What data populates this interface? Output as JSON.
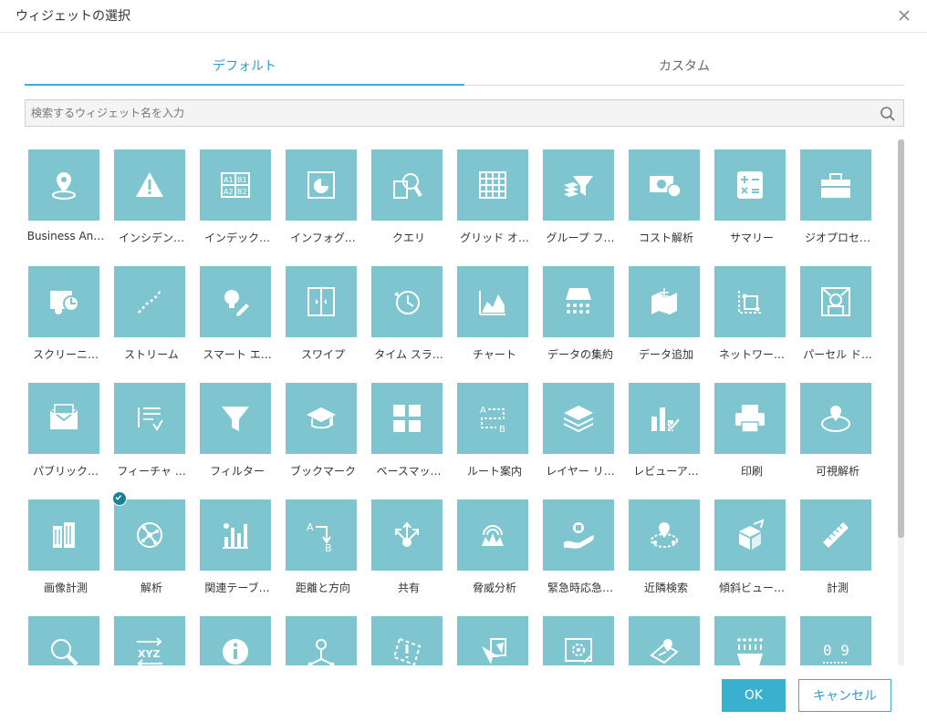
{
  "dialog": {
    "title": "ウィジェットの選択",
    "close_icon": "close-icon"
  },
  "tabs": [
    {
      "label": "デフォルト",
      "active": true
    },
    {
      "label": "カスタム",
      "active": false
    }
  ],
  "search": {
    "placeholder": "検索するウィジェット名を入力",
    "value": "",
    "icon": "search-icon"
  },
  "widgets": [
    {
      "label": "Business An…",
      "icon": "location-pin-icon"
    },
    {
      "label": "インシデン…",
      "icon": "warning-icon"
    },
    {
      "label": "インデック…",
      "icon": "index-grid-icon"
    },
    {
      "label": "インフォグ…",
      "icon": "pie-chart-icon"
    },
    {
      "label": "クエリ",
      "icon": "query-icon"
    },
    {
      "label": "グリッド オ…",
      "icon": "grid-icon"
    },
    {
      "label": "グループ フ…",
      "icon": "group-filter-icon"
    },
    {
      "label": "コスト解析",
      "icon": "cost-icon"
    },
    {
      "label": "サマリー",
      "icon": "calculator-icon"
    },
    {
      "label": "ジオプロセ…",
      "icon": "toolbox-icon"
    },
    {
      "label": "スクリーニ…",
      "icon": "screening-icon"
    },
    {
      "label": "ストリーム",
      "icon": "stream-icon"
    },
    {
      "label": "スマート エ…",
      "icon": "smart-editor-icon"
    },
    {
      "label": "スワイプ",
      "icon": "swipe-icon"
    },
    {
      "label": "タイム スラ…",
      "icon": "clock-icon"
    },
    {
      "label": "チャート",
      "icon": "area-chart-icon"
    },
    {
      "label": "データの集約",
      "icon": "data-aggregation-icon"
    },
    {
      "label": "データ追加",
      "icon": "add-data-icon"
    },
    {
      "label": "ネットワー…",
      "icon": "network-icon"
    },
    {
      "label": "パーセル ド…",
      "icon": "parcel-icon"
    },
    {
      "label": "パブリック…",
      "icon": "envelope-icon"
    },
    {
      "label": "フィーチャ …",
      "icon": "feature-list-icon"
    },
    {
      "label": "フィルター",
      "icon": "filter-icon"
    },
    {
      "label": "ブックマーク",
      "icon": "bookmark-icon"
    },
    {
      "label": "ベースマッ…",
      "icon": "basemap-icon"
    },
    {
      "label": "ルート案内",
      "icon": "route-icon"
    },
    {
      "label": "レイヤー リ…",
      "icon": "layers-icon"
    },
    {
      "label": "レビューア…",
      "icon": "reviewer-icon"
    },
    {
      "label": "印刷",
      "icon": "print-icon"
    },
    {
      "label": "可視解析",
      "icon": "viewshed-icon"
    },
    {
      "label": "画像計測",
      "icon": "building-icon"
    },
    {
      "label": "解析",
      "icon": "analysis-icon",
      "selected": true
    },
    {
      "label": "関連テーブ…",
      "icon": "bar-chart-icon"
    },
    {
      "label": "距離と方向",
      "icon": "distance-direction-icon"
    },
    {
      "label": "共有",
      "icon": "share-icon"
    },
    {
      "label": "脅威分析",
      "icon": "threat-icon"
    },
    {
      "label": "緊急時応急…",
      "icon": "emergency-icon"
    },
    {
      "label": "近隣検索",
      "icon": "near-me-icon"
    },
    {
      "label": "傾斜ビュー…",
      "icon": "oblique-icon"
    },
    {
      "label": "計測",
      "icon": "ruler-icon"
    },
    {
      "label": "",
      "icon": "magnifier-icon"
    },
    {
      "label": "",
      "icon": "xyz-icon"
    },
    {
      "label": "",
      "icon": "info-icon"
    },
    {
      "label": "",
      "icon": "geo-lookup-icon"
    },
    {
      "label": "",
      "icon": "edit-area-icon"
    },
    {
      "label": "",
      "icon": "select-icon"
    },
    {
      "label": "",
      "icon": "settings-icon"
    },
    {
      "label": "",
      "icon": "map-tag-icon"
    },
    {
      "label": "",
      "icon": "grid-points-icon"
    },
    {
      "label": "",
      "icon": "digits-icon"
    }
  ],
  "buttons": {
    "ok": "OK",
    "cancel": "キャンセル"
  },
  "colors": {
    "accent": "#3ab0cf",
    "tile": "#7fc5cf",
    "selected_badge": "#1c7f9a"
  }
}
